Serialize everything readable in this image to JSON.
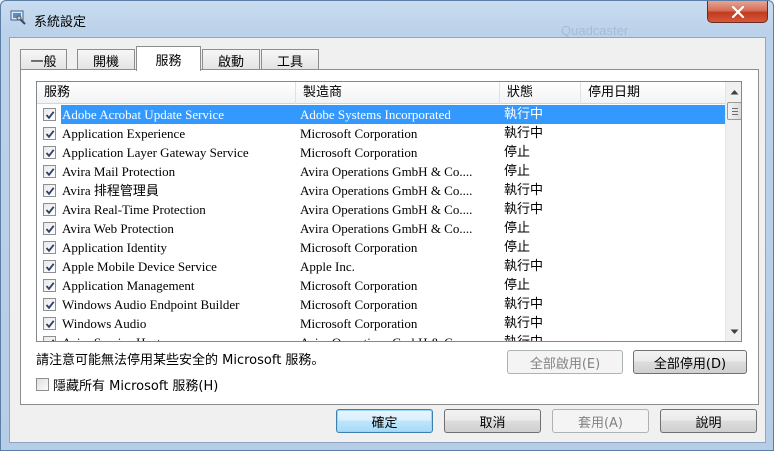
{
  "window": {
    "title": "系統設定",
    "background_ghost_text": "Quadcaster"
  },
  "tabs": [
    {
      "label": "一般",
      "active": false
    },
    {
      "label": "開機",
      "active": false
    },
    {
      "label": "服務",
      "active": true
    },
    {
      "label": "啟動",
      "active": false
    },
    {
      "label": "工具",
      "active": false
    }
  ],
  "columns": {
    "service": "服務",
    "manufacturer": "製造商",
    "status": "狀態",
    "disabled_date": "停用日期"
  },
  "rows": [
    {
      "name": "Adobe Acrobat Update Service",
      "vendor": "Adobe Systems Incorporated",
      "status": "執行中",
      "checked": true
    },
    {
      "name": "Application Experience",
      "vendor": "Microsoft Corporation",
      "status": "執行中",
      "checked": true
    },
    {
      "name": "Application Layer Gateway Service",
      "vendor": "Microsoft Corporation",
      "status": "停止",
      "checked": true
    },
    {
      "name": "Avira Mail Protection",
      "vendor": "Avira Operations GmbH & Co....",
      "status": "停止",
      "checked": true
    },
    {
      "name": "Avira 排程管理員",
      "vendor": "Avira Operations GmbH & Co....",
      "status": "執行中",
      "checked": true
    },
    {
      "name": "Avira Real-Time Protection",
      "vendor": "Avira Operations GmbH & Co....",
      "status": "執行中",
      "checked": true
    },
    {
      "name": "Avira Web Protection",
      "vendor": "Avira Operations GmbH & Co....",
      "status": "停止",
      "checked": true
    },
    {
      "name": "Application Identity",
      "vendor": "Microsoft Corporation",
      "status": "停止",
      "checked": true
    },
    {
      "name": "Apple Mobile Device Service",
      "vendor": "Apple Inc.",
      "status": "執行中",
      "checked": true
    },
    {
      "name": "Application Management",
      "vendor": "Microsoft Corporation",
      "status": "停止",
      "checked": true
    },
    {
      "name": "Windows Audio Endpoint Builder",
      "vendor": "Microsoft Corporation",
      "status": "執行中",
      "checked": true
    },
    {
      "name": "Windows Audio",
      "vendor": "Microsoft Corporation",
      "status": "執行中",
      "checked": true
    },
    {
      "name": "Avira Service Host",
      "vendor": "Avira Operations GmbH & Co....",
      "status": "執行中",
      "checked": true
    }
  ],
  "selected_row": 0,
  "note": "請注意可能無法停用某些安全的 Microsoft 服務。",
  "buttons": {
    "enable_all": "全部啟用(E)",
    "disable_all": "全部停用(D)",
    "ok": "確定",
    "cancel": "取消",
    "apply": "套用(A)",
    "help": "說明"
  },
  "hide_ms_label": "隱藏所有 Microsoft 服務(H)",
  "colors": {
    "selection": "#3399ff",
    "close_button": "#c23a1e"
  }
}
